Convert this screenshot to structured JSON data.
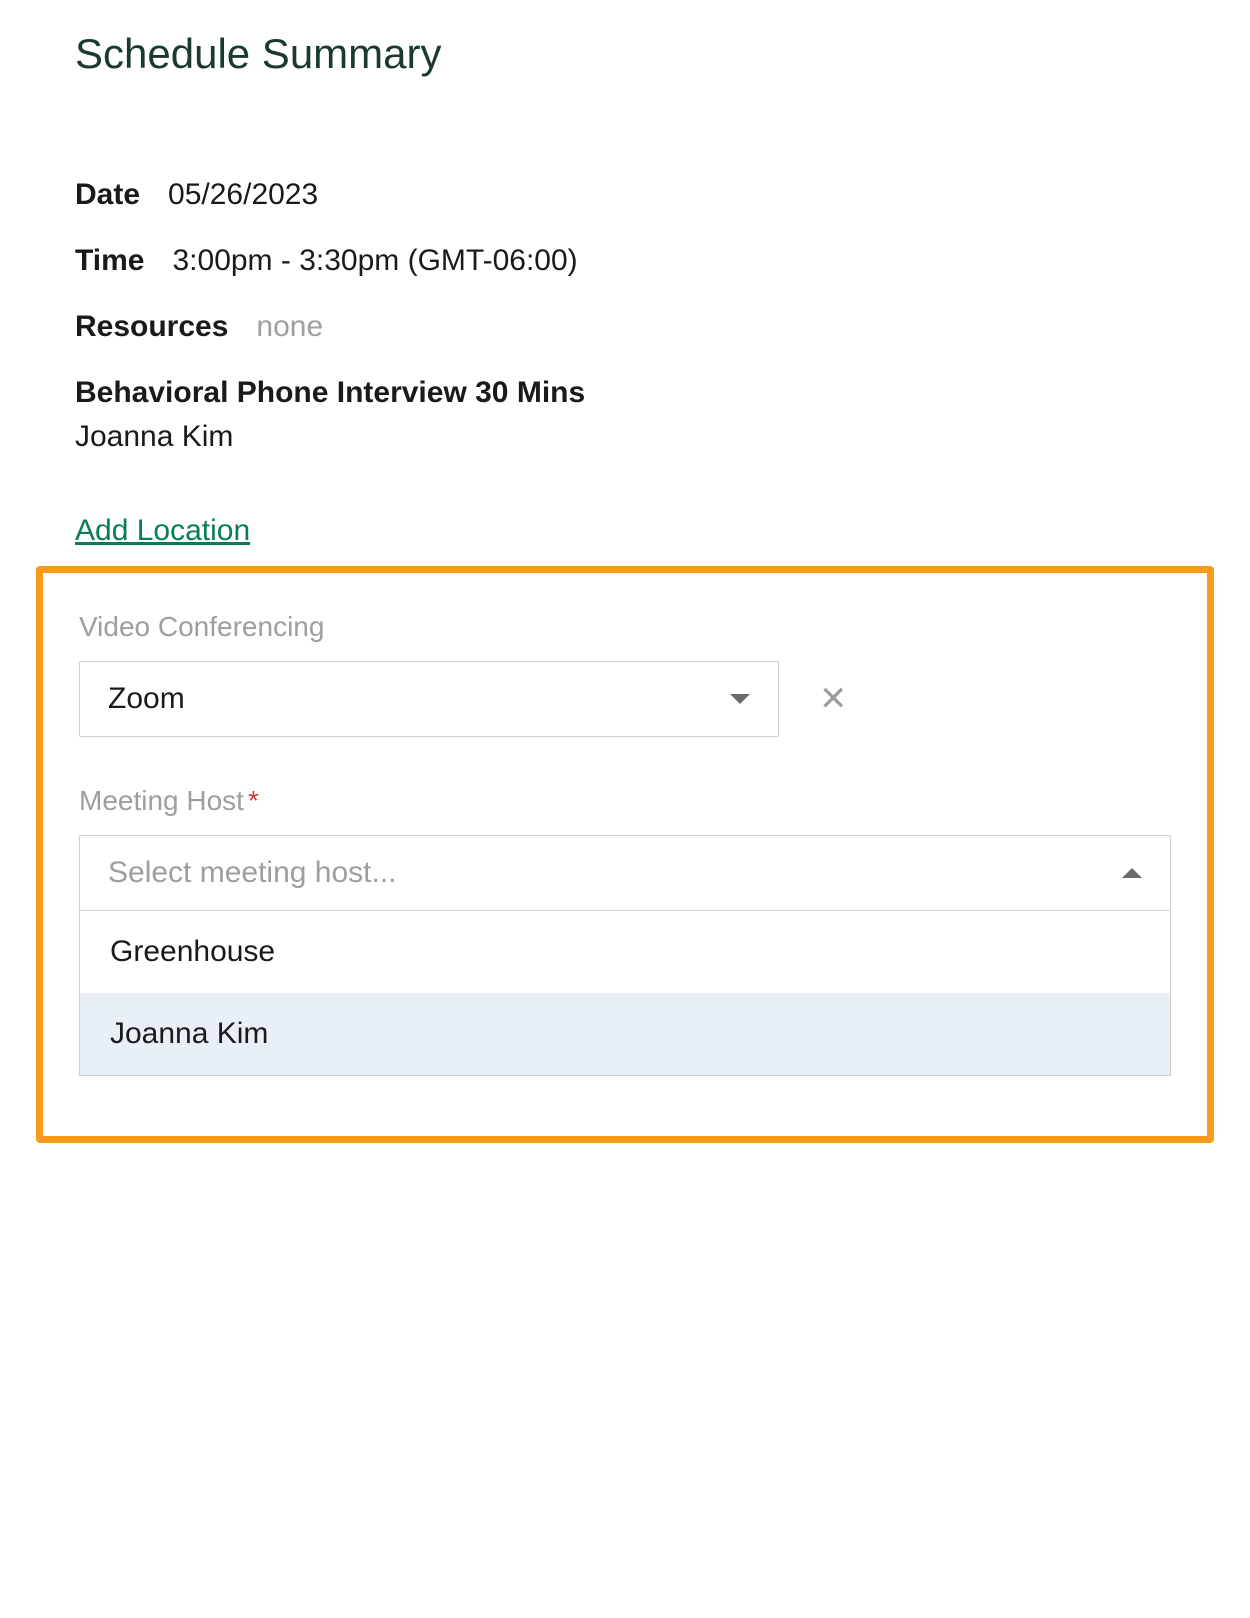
{
  "title": "Schedule Summary",
  "summary": {
    "date_label": "Date",
    "date_value": "05/26/2023",
    "time_label": "Time",
    "time_value": "3:00pm - 3:30pm (GMT-06:00)",
    "resources_label": "Resources",
    "resources_value": "none"
  },
  "interview": {
    "title": "Behavioral Phone Interview 30 Mins",
    "person": "Joanna Kim"
  },
  "add_location_label": "Add Location",
  "video_conferencing": {
    "label": "Video Conferencing",
    "selected": "Zoom"
  },
  "meeting_host": {
    "label": "Meeting Host",
    "placeholder": "Select meeting host...",
    "options": [
      {
        "label": "Greenhouse",
        "highlighted": false
      },
      {
        "label": "Joanna Kim",
        "highlighted": true
      }
    ]
  }
}
